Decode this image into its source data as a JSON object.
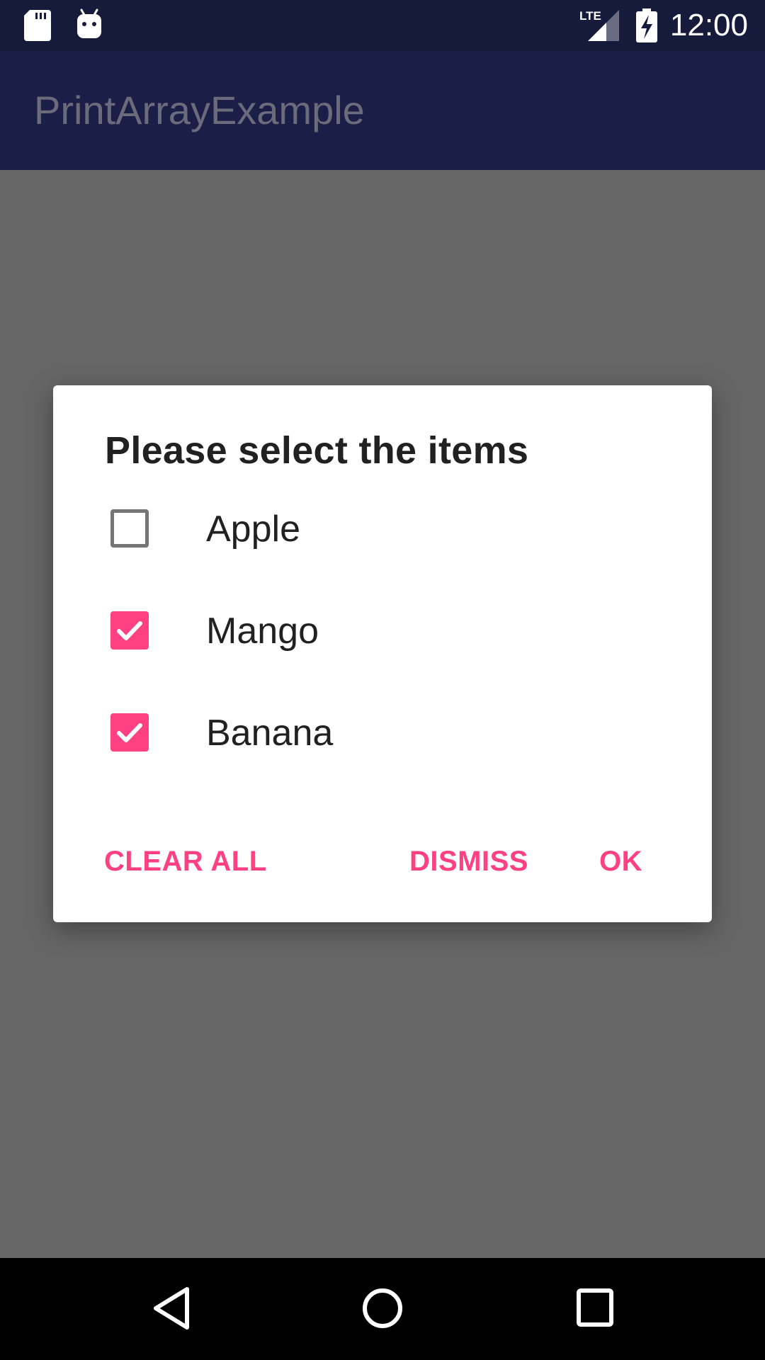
{
  "status_bar": {
    "time": "12:00",
    "icons": [
      "sd-card-icon",
      "android-debug-icon",
      "lte-signal-icon",
      "battery-charging-icon"
    ],
    "network_label": "LTE"
  },
  "app_bar": {
    "title": "PrintArrayExample"
  },
  "dialog": {
    "title": "Please select the items",
    "options": [
      {
        "label": "Apple",
        "checked": false
      },
      {
        "label": "Mango",
        "checked": true
      },
      {
        "label": "Banana",
        "checked": true
      }
    ],
    "buttons": {
      "clear_all": "CLEAR ALL",
      "dismiss": "DISMISS",
      "ok": "OK"
    }
  },
  "nav_bar": {
    "icons": [
      "back-icon",
      "home-icon",
      "recents-icon"
    ]
  },
  "colors": {
    "accent": "#ff4081",
    "status_bar": "#161a3b",
    "app_bar": "#1b1f47",
    "scrim": "#666666"
  }
}
